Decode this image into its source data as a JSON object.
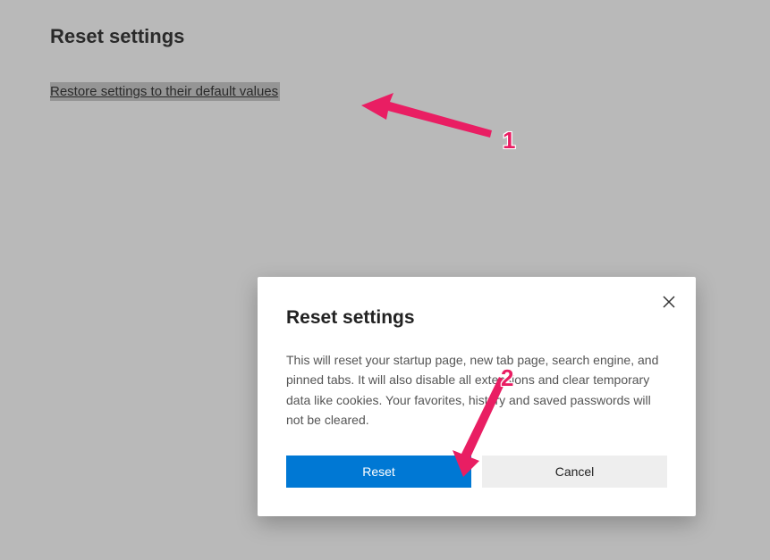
{
  "header": {
    "title": "Reset settings"
  },
  "restore_link": {
    "text": "Restore settings to their default values"
  },
  "dialog": {
    "title": "Reset settings",
    "body": "This will reset your startup page, new tab page, search engine, and pinned tabs. It will also disable all extensions and clear temporary data like cookies. Your favorites, history and saved passwords will not be cleared.",
    "primary_label": "Reset",
    "secondary_label": "Cancel"
  },
  "annotations": {
    "label1": "1",
    "label2": "2"
  }
}
